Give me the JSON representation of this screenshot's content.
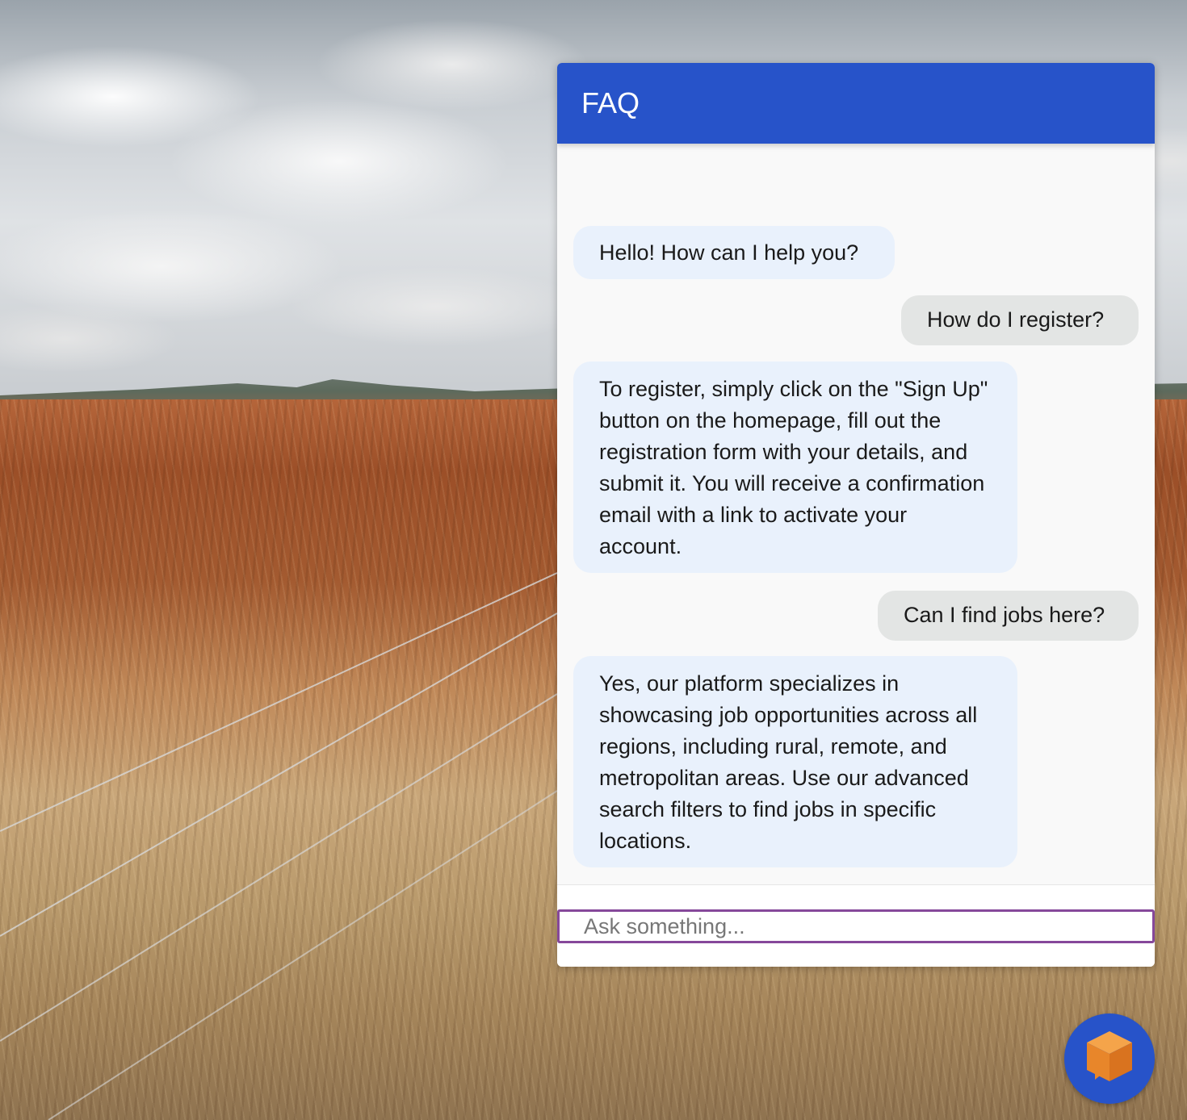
{
  "chat": {
    "title": "FAQ",
    "messages": [
      {
        "role": "bot",
        "text": "Hello! How can I help you?"
      },
      {
        "role": "user",
        "text": "How do I register?"
      },
      {
        "role": "bot",
        "text": "To register, simply click on the \"Sign Up\" button on the homepage, fill out the registration form with your details, and submit it. You will receive a confirmation email with a link to activate your account."
      },
      {
        "role": "user",
        "text": "Can I find jobs here?"
      },
      {
        "role": "bot",
        "text": "Yes, our platform specializes in showcasing job opportunities across all regions, including rural, remote, and metropolitan areas. Use our advanced search filters to find jobs in specific locations."
      }
    ],
    "input": {
      "placeholder": "Ask something...",
      "value": ""
    }
  },
  "launcher": {
    "icon": "chat-cube-icon"
  },
  "colors": {
    "header": "#2753c9",
    "bot_bubble": "#e9f1fc",
    "user_bubble": "#e3e5e4",
    "input_border": "#86489a",
    "launcher_icon": "#f08a2c"
  }
}
